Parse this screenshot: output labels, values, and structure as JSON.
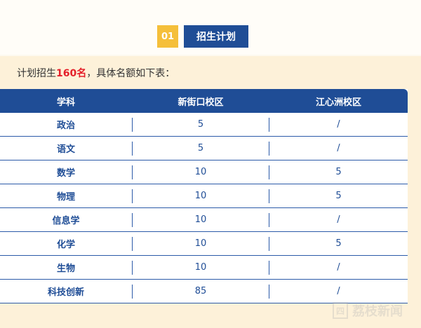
{
  "section": {
    "number": "01",
    "title": "招生计划"
  },
  "intro": {
    "prefix": "计划招生",
    "highlight": "160名",
    "suffix": "，具体名额如下表："
  },
  "table": {
    "headers": [
      "学科",
      "新街口校区",
      "江心洲校区"
    ],
    "rows": [
      [
        "政治",
        "5",
        "/"
      ],
      [
        "语文",
        "5",
        "/"
      ],
      [
        "数学",
        "10",
        "5"
      ],
      [
        "物理",
        "10",
        "5"
      ],
      [
        "信息学",
        "10",
        "/"
      ],
      [
        "化学",
        "10",
        "5"
      ],
      [
        "生物",
        "10",
        "/"
      ],
      [
        "科技创新",
        "85",
        "/"
      ]
    ]
  },
  "watermark": {
    "mark": "四",
    "text": "荔枝新闻"
  },
  "colors": {
    "accent_blue": "#1f4d96",
    "badge_yellow": "#f5bf3a",
    "highlight_red": "#e4202a",
    "panel_bg": "#fdf1d9"
  }
}
